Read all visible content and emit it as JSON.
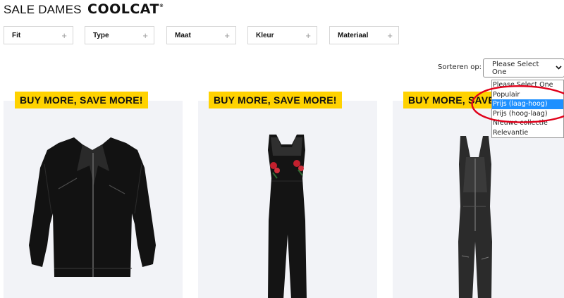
{
  "header": {
    "title": "SALE DAMES",
    "brand": "COOLCAT",
    "brand_mark": "®"
  },
  "filters": [
    {
      "label": "Fit"
    },
    {
      "label": "Type"
    },
    {
      "label": "Maat"
    },
    {
      "label": "Kleur"
    },
    {
      "label": "Materiaal"
    }
  ],
  "sort": {
    "label": "Sorteren op:",
    "value": "Please Select One",
    "options": [
      "Please Select One",
      "Populair",
      "Prijs (laag-hoog)",
      "Prijs (hoog-laag)",
      "Nieuwe collectie",
      "Relevantie"
    ],
    "highlighted_option": "Prijs (laag-hoog)"
  },
  "products": [
    {
      "badge": "BUY MORE, SAVE MORE!",
      "image": "black-leather-biker-jacket"
    },
    {
      "badge": "BUY MORE, SAVE MORE!",
      "image": "black-jumpsuit-floral-embroidery"
    },
    {
      "badge": "BUY MORE, SAVE MORE!",
      "image": "black-denim-overall-jumpsuit"
    }
  ],
  "colors": {
    "badge_bg": "#ffd200",
    "card_bg": "#f2f3f7",
    "highlight": "#1e90ff",
    "annotation": "#e0001a"
  }
}
